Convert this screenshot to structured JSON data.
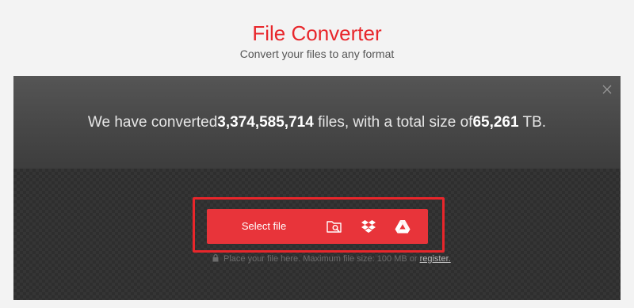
{
  "header": {
    "title": "File Converter",
    "subtitle": "Convert your files to any format"
  },
  "stats": {
    "prefix": "We have converted",
    "file_count": "3,374,585,714",
    "middle": " files, with a total size of",
    "total_size": "65,261",
    "unit": " TB."
  },
  "upload": {
    "select_label": "Select file",
    "sources": [
      "folder-search-icon",
      "dropbox-icon",
      "google-drive-icon"
    ]
  },
  "hint": {
    "text": "Place your file here. Maximum file size: 100 MB or ",
    "link": "register."
  },
  "colors": {
    "brand": "#e8262b",
    "button": "#e8343a",
    "panel": "#2c2c2c"
  }
}
